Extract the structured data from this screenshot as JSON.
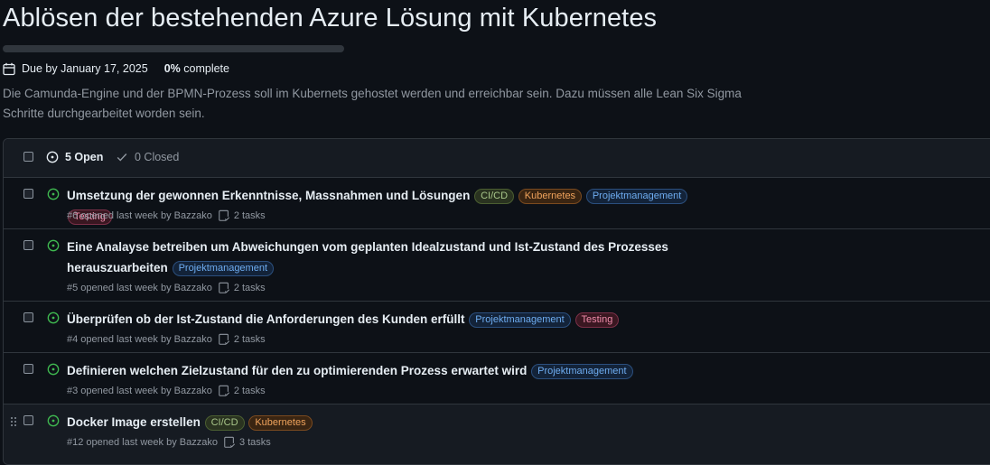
{
  "milestone": {
    "title": "Ablösen der bestehenden Azure Lösung mit Kubernetes",
    "progress_percent": 0,
    "due_text": "Due by January 17, 2025",
    "complete_value": "0%",
    "complete_text": "complete",
    "description": "Die Camunda-Engine und der BPMN-Prozess soll im Kubernets gehostet werden und erreichbar sein. Dazu müssen alle Lean Six Sigma Schritte durchgearbeitet worden sein."
  },
  "tabs": {
    "open": "5 Open",
    "closed": "0 Closed"
  },
  "labels": {
    "cicd": "CI/CD",
    "kubernetes": "Kubernetes",
    "pm": "Projektmanagement",
    "testing": "Testing"
  },
  "colors": {
    "background": "#0d1117",
    "open_green": "#3fb950",
    "label_cicd": "#a8c68a",
    "label_kubernetes": "#f0a35c",
    "label_pm": "#6eacf0",
    "label_testing": "#f08cab"
  },
  "issues": [
    {
      "title": "Umsetzung der gewonnen Erkenntnisse, Massnahmen und Lösungen",
      "meta": "#6 opened last week by Bazzako",
      "tasks": "2 tasks"
    },
    {
      "title": "Eine Analayse betreiben um Abweichungen vom geplanten Idealzustand und Ist-Zustand des Prozesses herauszuarbeiten",
      "meta": "#5 opened last week by Bazzako",
      "tasks": "2 tasks"
    },
    {
      "title": "Überprüfen ob der Ist-Zustand die Anforderungen des Kunden erfüllt",
      "meta": "#4 opened last week by Bazzako",
      "tasks": "2 tasks"
    },
    {
      "title": "Definieren welchen Zielzustand für den zu optimierenden Prozess erwartet wird",
      "meta": "#3 opened last week by Bazzako",
      "tasks": "2 tasks"
    },
    {
      "title": "Docker Image erstellen",
      "meta": "#12 opened last week by Bazzako",
      "tasks": "3 tasks"
    }
  ]
}
